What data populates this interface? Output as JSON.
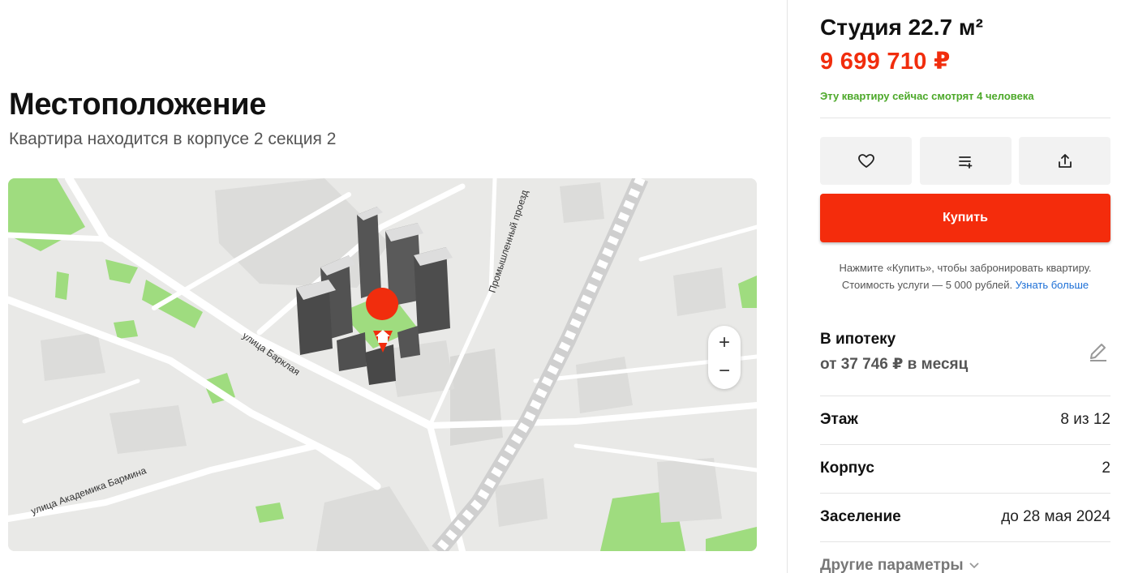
{
  "location": {
    "title": "Местоположение",
    "subtitle": "Квартира находится в корпусе 2 секция 2"
  },
  "map": {
    "streets": [
      "улица Барклая",
      "Промышленный проезд",
      "улица Академика Бармина"
    ],
    "zoom_in": "+",
    "zoom_out": "−",
    "pin_icon": "home-pin-icon",
    "colors": {
      "background": "#e9e9e7",
      "green": "#9fdc7f",
      "pin": "#f12d0d"
    }
  },
  "listing": {
    "title": "Студия 22.7 м²",
    "price": "9 699 710 ₽",
    "watching": "Эту квартиру сейчас смотрят 4 человека",
    "actions": [
      {
        "icon": "heart-icon"
      },
      {
        "icon": "compare-list-icon"
      },
      {
        "icon": "share-icon"
      }
    ],
    "buy_label": "Купить",
    "hint_line1": "Нажмите «Купить», чтобы забронировать квартиру.",
    "hint_line2": "Стоимость услуги — 5 000 рублей.",
    "hint_link": "Узнать больше",
    "colors": {
      "accent": "#f42c0c",
      "price": "#f12d0d",
      "watching": "#4ca829",
      "link": "#1c6fd6"
    }
  },
  "mortgage": {
    "title": "В ипотеку",
    "monthly": "от 37 746 ₽ в месяц"
  },
  "params": [
    {
      "label": "Этаж",
      "value": "8 из 12"
    },
    {
      "label": "Корпус",
      "value": "2"
    },
    {
      "label": "Заселение",
      "value": "до 28 мая 2024"
    }
  ],
  "more_label": "Другие параметры"
}
